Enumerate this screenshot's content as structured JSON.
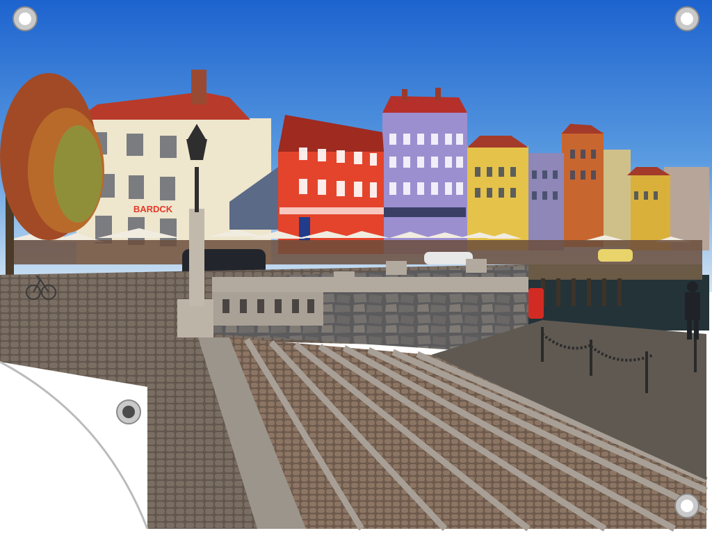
{
  "scene": {
    "shop_sign": "BARDCK",
    "sky_top": "#1f6fd6",
    "sky_bottom": "#cfe2f2",
    "sign_color": "#e23a2a",
    "grommet_color": "#c9c9c9"
  }
}
